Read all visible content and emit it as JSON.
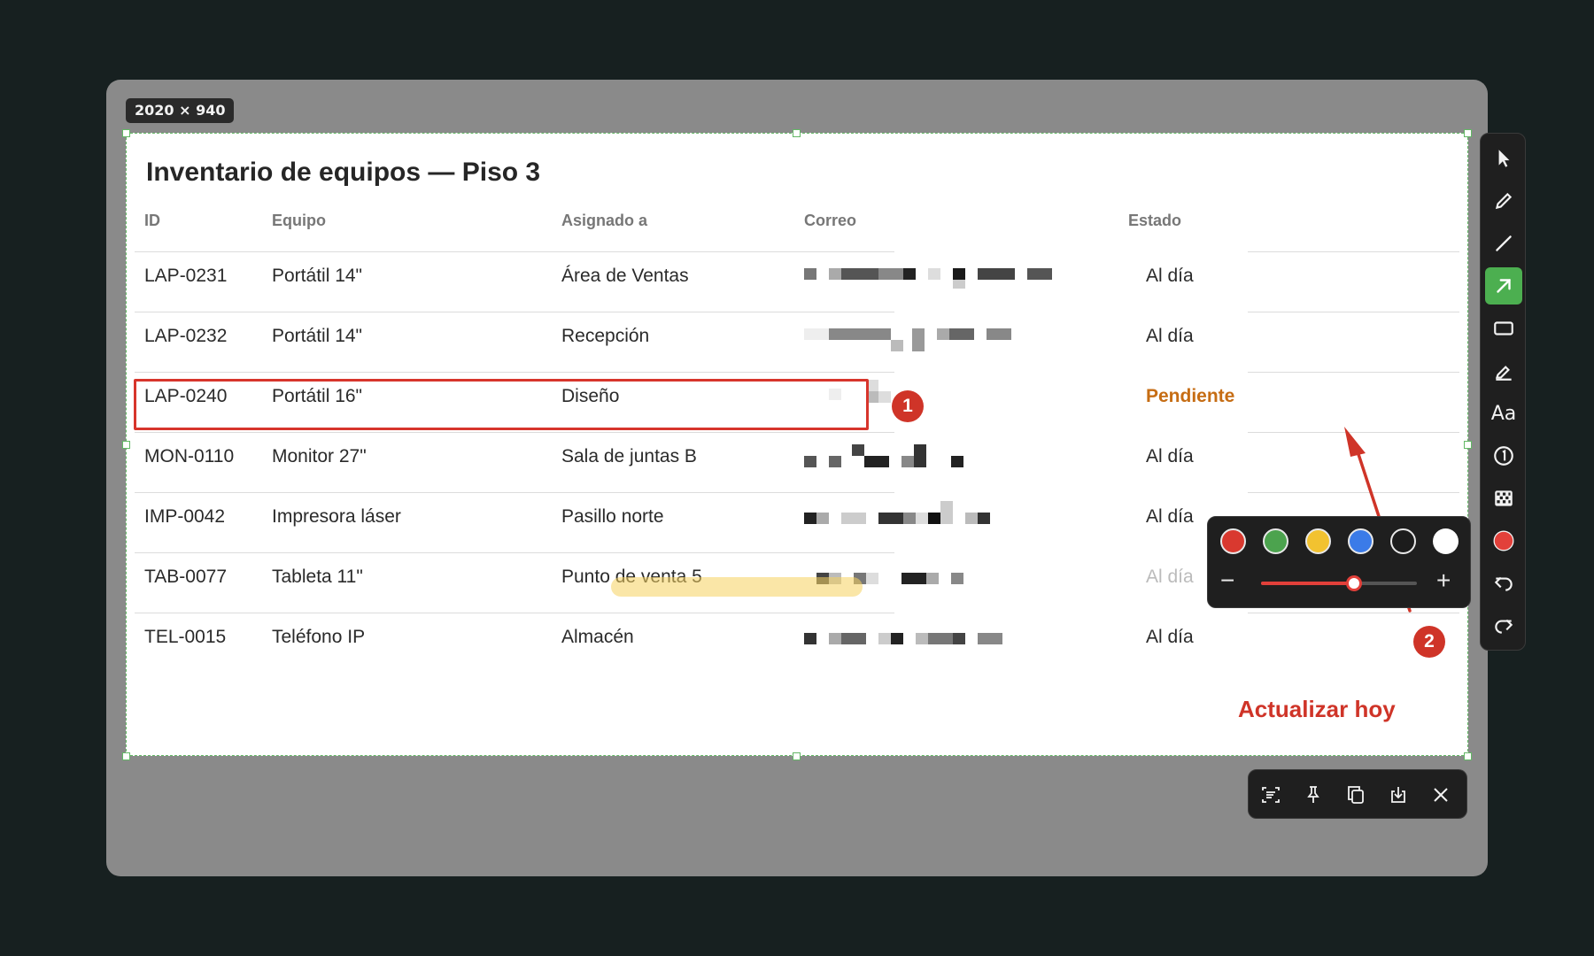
{
  "capture": {
    "size_label": "2020 × 940"
  },
  "document": {
    "title": "Inventario de equipos — Piso 3",
    "columns": [
      "ID",
      "Equipo",
      "Asignado a",
      "Correo",
      "Estado"
    ],
    "rows": [
      {
        "id": "LAP-0231",
        "equipo": "Portátil 14\"",
        "asignado": "Área de Ventas",
        "estado": "Al día"
      },
      {
        "id": "LAP-0232",
        "equipo": "Portátil 14\"",
        "asignado": "Recepción",
        "estado": "Al día"
      },
      {
        "id": "LAP-0240",
        "equipo": "Portátil 16\"",
        "asignado": "Diseño",
        "estado": "Pendiente"
      },
      {
        "id": "MON-0110",
        "equipo": "Monitor 27\"",
        "asignado": "Sala de juntas B",
        "estado": "Al día"
      },
      {
        "id": "IMP-0042",
        "equipo": "Impresora láser",
        "asignado": "Pasillo norte",
        "estado": "Al día"
      },
      {
        "id": "TAB-0077",
        "equipo": "Tableta 11\"",
        "asignado": "Punto de venta 5",
        "estado": "Al día"
      },
      {
        "id": "TEL-0015",
        "equipo": "Teléfono IP",
        "asignado": "Almacén",
        "estado": "Al día"
      }
    ],
    "email_cells_state": "pixelated"
  },
  "annotations": {
    "step1": "1",
    "step2": "2",
    "note": "Actualizar hoy",
    "color_red": "#cf3428",
    "highlighter_color": "#f6d15e"
  },
  "toolbar": {
    "tools": [
      {
        "name": "select",
        "icon": "cursor-icon"
      },
      {
        "name": "pen",
        "icon": "pen-icon"
      },
      {
        "name": "line",
        "icon": "line-icon"
      },
      {
        "name": "arrow",
        "icon": "arrow-icon",
        "active": true
      },
      {
        "name": "rectangle",
        "icon": "rectangle-icon"
      },
      {
        "name": "highlighter",
        "icon": "highlighter-icon"
      },
      {
        "name": "text",
        "icon": "text-icon",
        "label": "Aa"
      },
      {
        "name": "step",
        "icon": "step-number-icon"
      },
      {
        "name": "mosaic",
        "icon": "mosaic-icon"
      },
      {
        "name": "color",
        "icon": "color-dot-icon"
      },
      {
        "name": "undo",
        "icon": "undo-icon"
      },
      {
        "name": "redo",
        "icon": "redo-icon"
      }
    ],
    "active_color": "#e2403a"
  },
  "palette": {
    "colors": [
      "#d9392f",
      "#4ca34e",
      "#f2c230",
      "#3b7be8",
      "#1c1c1c",
      "#ffffff"
    ],
    "selected": "#d9392f",
    "size_fraction": 0.6
  },
  "actions": {
    "items": [
      "ocr-icon",
      "pin-icon",
      "copy-icon",
      "save-icon",
      "close-icon"
    ]
  }
}
